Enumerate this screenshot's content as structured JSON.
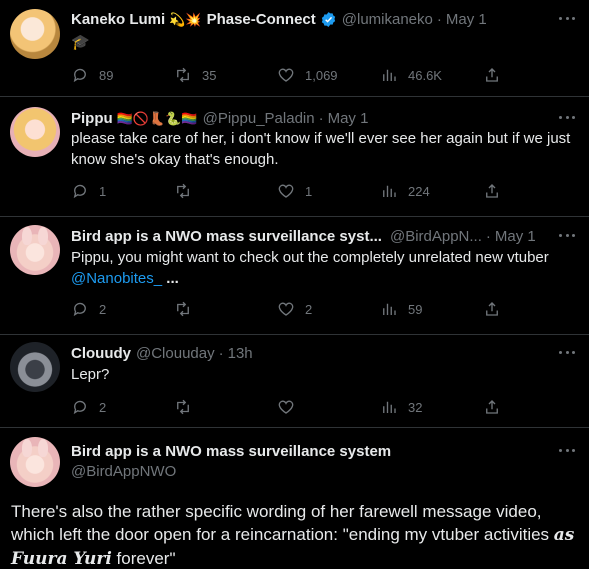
{
  "tweets": [
    {
      "name": "Kaneko Lumi",
      "emojis": "💫💥",
      "org": "Phase-Connect",
      "handle": "@lumikaneko",
      "time": "May 1",
      "text": "🎓",
      "replies": "89",
      "retweets": "35",
      "likes": "1,069",
      "views": "46.6K"
    },
    {
      "name": "Pippu",
      "emojis": "🏳️‍🌈🚫👢🐍🏳️‍🌈",
      "handle": "@Pippu_Paladin",
      "time": "May 1",
      "text": "please take care of her, i don't know if we'll ever see her again but if we just know she's okay that's enough.",
      "replies": "1",
      "retweets": "",
      "likes": "1",
      "views": "224"
    },
    {
      "name": "Bird app is a NWO mass surveillance syst...",
      "handle": "@BirdAppN...",
      "time": "May 1",
      "text": "Pippu, you might want to check out the completely unrelated new vtuber",
      "mention": "@Nanobites_",
      "ellipsis": " ...",
      "replies": "2",
      "retweets": "",
      "likes": "2",
      "views": "59"
    },
    {
      "name": "Clouudy",
      "handle": "@Clouuday",
      "time": "13h",
      "text": "Lepr?",
      "replies": "2",
      "retweets": "",
      "likes": "",
      "views": "32"
    }
  ],
  "main_tweet": {
    "name": "Bird app is a NWO mass surveillance system",
    "handle": "@BirdAppNWO",
    "text_start": "There's also the rather specific wording of her farewell message video, which left the door open for a reincarnation: \"ending my vtuber activities ",
    "text_em": "as Fuura Yuri",
    "text_end": " forever\""
  },
  "colors": {
    "background": "#000000",
    "text": "#e7e9ea",
    "muted": "#71767b",
    "link": "#1d9bf0",
    "divider": "#2f3336"
  },
  "icons": [
    "reply-icon",
    "retweet-icon",
    "like-icon",
    "views-icon",
    "share-icon",
    "more-icon",
    "verified-icon"
  ]
}
